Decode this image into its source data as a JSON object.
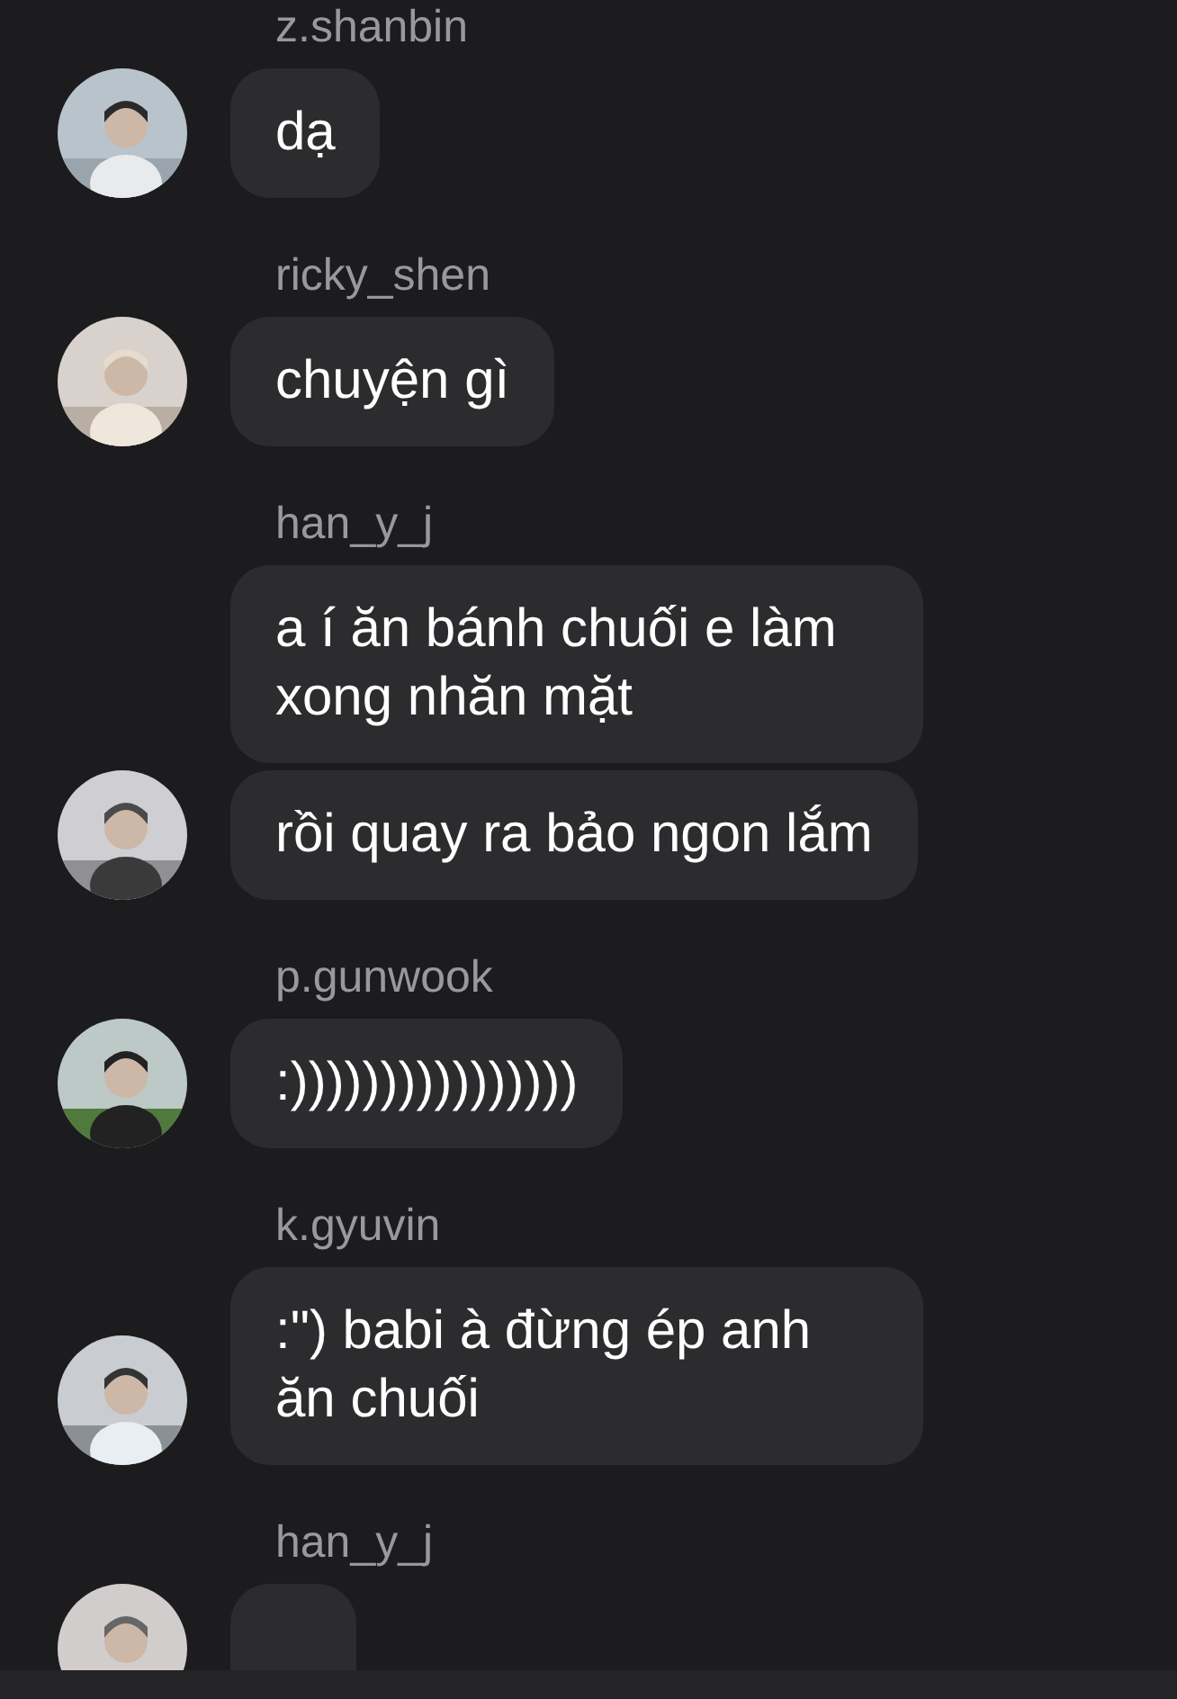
{
  "groups": [
    {
      "username": "z.shanbin",
      "messages": [
        {
          "text": "dạ"
        }
      ]
    },
    {
      "username": "ricky_shen",
      "messages": [
        {
          "text": "chuyện gì"
        }
      ]
    },
    {
      "username": "han_y_j",
      "messages": [
        {
          "text": "a í ăn bánh chuối e làm xong nhăn mặt"
        },
        {
          "text": "rồi quay ra bảo ngon lắm"
        }
      ]
    },
    {
      "username": "p.gunwook",
      "messages": [
        {
          "text": ":))))))))))))))))"
        }
      ]
    },
    {
      "username": "k.gyuvin",
      "messages": [
        {
          "text": ":\") babi à đừng ép anh ăn chuối"
        }
      ]
    },
    {
      "username": "han_y_j",
      "partial_bubble": true
    }
  ]
}
